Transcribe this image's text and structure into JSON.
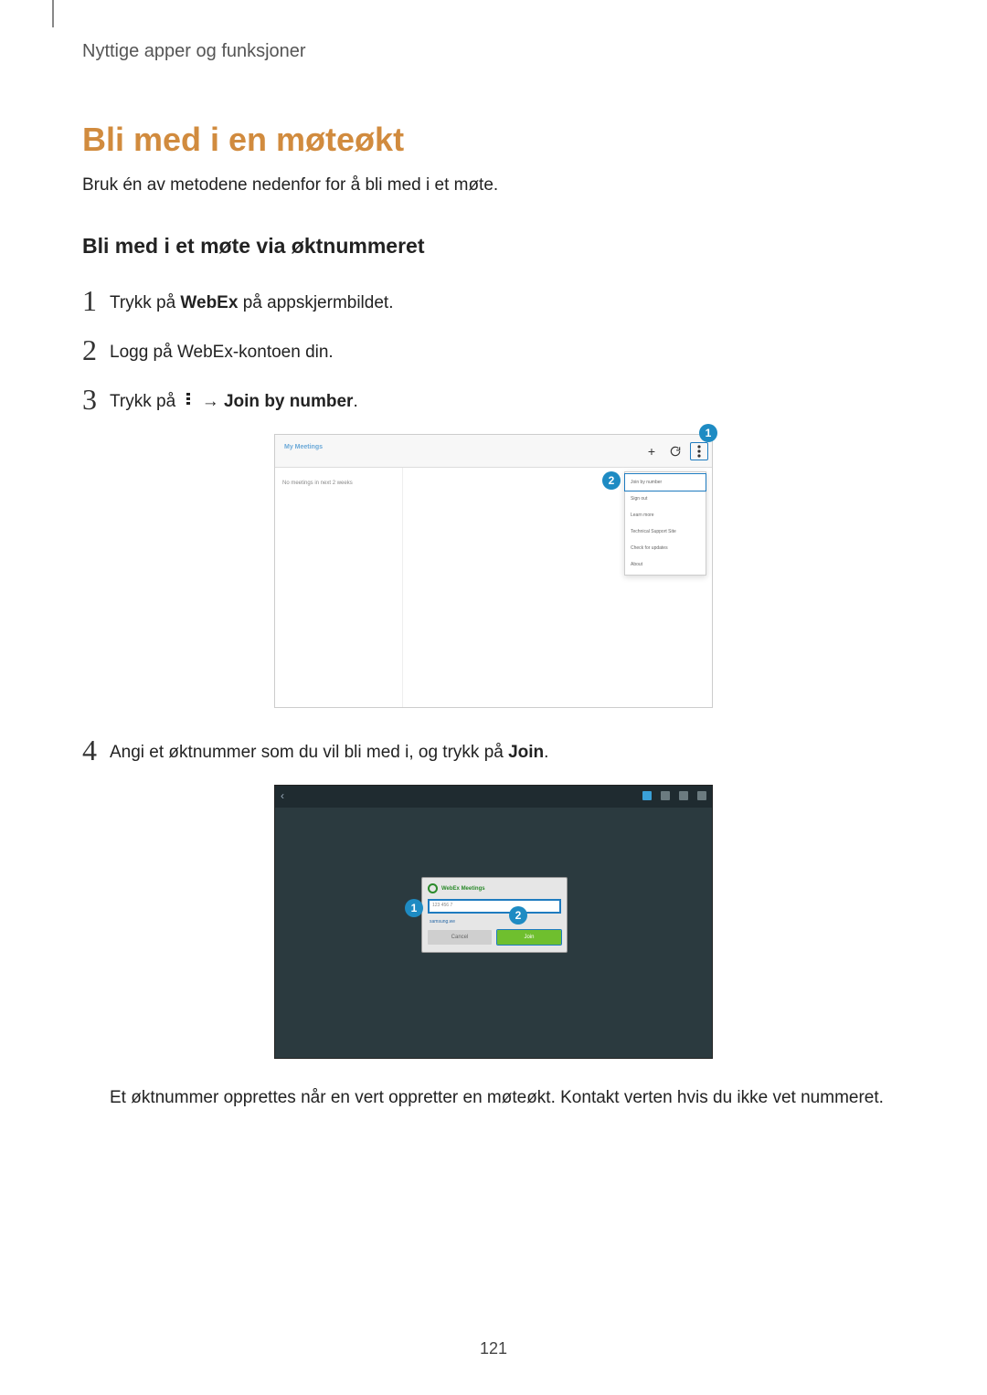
{
  "breadcrumb": "Nyttige apper og funksjoner",
  "heading": "Bli med i en møteøkt",
  "intro": "Bruk én av metodene nedenfor for å bli med i et møte.",
  "subheading": "Bli med i et møte via øktnummeret",
  "steps": {
    "s1": {
      "num": "1",
      "pre": "Trykk på ",
      "bold": "WebEx",
      "post": " på appskjermbildet."
    },
    "s2": {
      "num": "2",
      "text": "Logg på WebEx-kontoen din."
    },
    "s3": {
      "num": "3",
      "pre": "Trykk på ",
      "arrow": "→",
      "bold": "Join by number",
      "post": "."
    },
    "s4": {
      "num": "4",
      "pre": "Angi et øktnummer som du vil bli med i, og trykk på ",
      "bold": "Join",
      "post": "."
    }
  },
  "note": "Et øktnummer opprettes når en vert oppretter en møteøkt. Kontakt verten hvis du ikke vet nummeret.",
  "page_number": "121",
  "shot1": {
    "app_title": "My Meetings",
    "plus": "+",
    "sidebar_line": "No meetings in next 2 weeks",
    "menu": [
      "Join by number",
      "Sign out",
      "Learn more",
      "Technical Support Site",
      "Check for updates",
      "About"
    ],
    "badge1": "1",
    "badge2": "2"
  },
  "shot2": {
    "dialog_title": "WebEx Meetings",
    "input_placeholder": "123 456 7",
    "link": "samsung.we",
    "cancel": "Cancel",
    "join": "Join",
    "badge1": "1",
    "badge2": "2"
  }
}
